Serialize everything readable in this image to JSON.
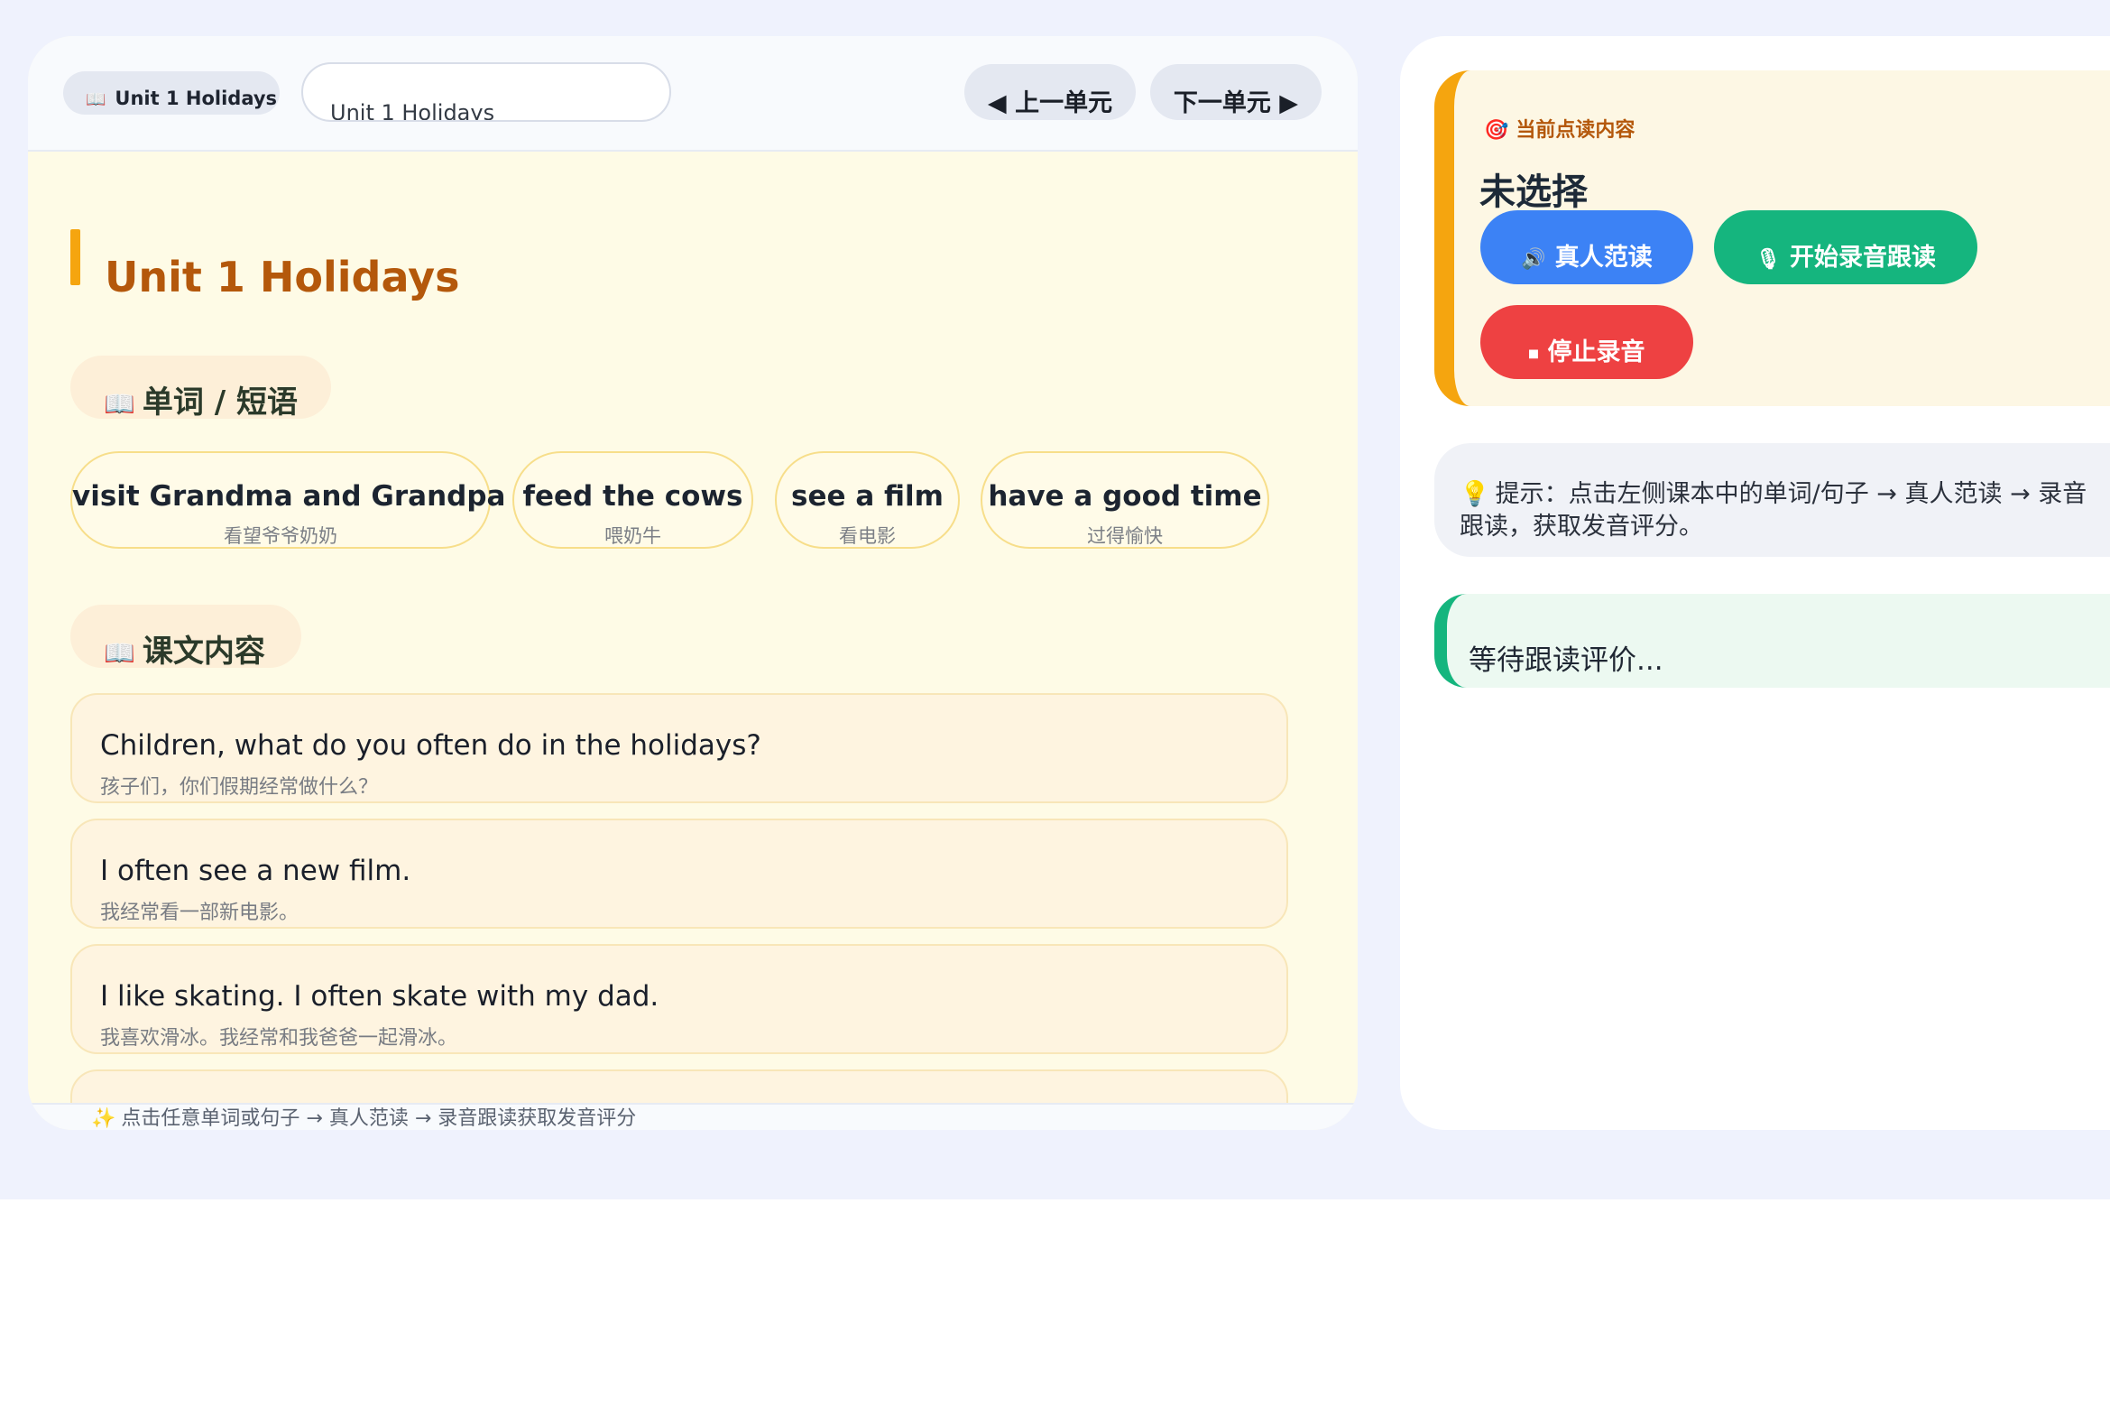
{
  "header": {
    "unit_badge": "Unit 1 Holidays",
    "unit_select_value": "Unit 1 Holidays",
    "prev_label": "◀ 上一单元",
    "next_label": "下一单元 ▶"
  },
  "lesson": {
    "title": "Unit 1 Holidays",
    "words_heading": "单词 / 短语",
    "text_heading": "课文内容",
    "words": [
      {
        "en": "visit Grandma and Grandpa",
        "zh": "看望爷爷奶奶"
      },
      {
        "en": "feed the cows",
        "zh": "喂奶牛"
      },
      {
        "en": "see a film",
        "zh": "看电影"
      },
      {
        "en": "have a good time",
        "zh": "过得愉快"
      }
    ],
    "sentences": [
      {
        "en": "Children, what do you often do in the holidays?",
        "zh": "孩子们，你们假期经常做什么？"
      },
      {
        "en": "I often see a new film.",
        "zh": "我经常看一部新电影。"
      },
      {
        "en": "I like skating. I often skate with my dad.",
        "zh": "我喜欢滑冰。我经常和我爸爸一起滑冰。"
      }
    ]
  },
  "footer": {
    "tip": "点击任意单词或句子 → 真人范读 → 录音跟读获取发音评分"
  },
  "side": {
    "current_label": "当前点读内容",
    "current_value": "未选择",
    "demo_button": "真人范读",
    "record_button": "开始录音跟读",
    "stop_button": "停止录音",
    "hint": "提示：点击左侧课本中的单词/句子 → 真人范读 → 录音跟读，获取发音评分。",
    "evaluation": "等待跟读评价..."
  },
  "icons": {
    "book": "book-icon",
    "sparkle": "sparkle-icon",
    "target": "target-icon",
    "speaker": "speaker-icon",
    "microphone": "microphone-icon",
    "stop": "stop-icon",
    "bulb": "lightbulb-icon"
  },
  "colors": {
    "accent_orange": "#f5a50f",
    "title_brown": "#b4580b",
    "blue": "#3c82f5",
    "green": "#15b57e",
    "red": "#ee4142"
  }
}
